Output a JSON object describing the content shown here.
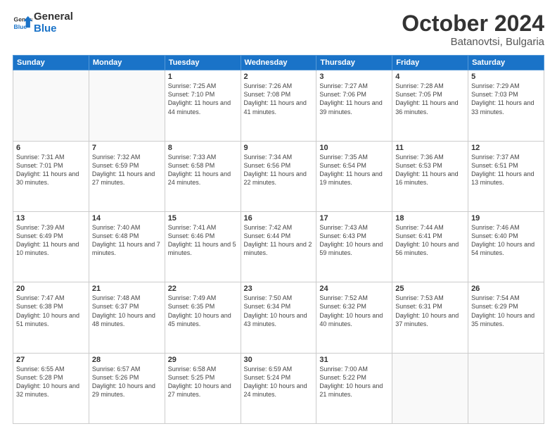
{
  "header": {
    "logo_line1": "General",
    "logo_line2": "Blue",
    "title": "October 2024",
    "subtitle": "Batanovtsi, Bulgaria"
  },
  "weekdays": [
    "Sunday",
    "Monday",
    "Tuesday",
    "Wednesday",
    "Thursday",
    "Friday",
    "Saturday"
  ],
  "weeks": [
    [
      {
        "day": "",
        "info": ""
      },
      {
        "day": "",
        "info": ""
      },
      {
        "day": "1",
        "info": "Sunrise: 7:25 AM\nSunset: 7:10 PM\nDaylight: 11 hours and 44 minutes."
      },
      {
        "day": "2",
        "info": "Sunrise: 7:26 AM\nSunset: 7:08 PM\nDaylight: 11 hours and 41 minutes."
      },
      {
        "day": "3",
        "info": "Sunrise: 7:27 AM\nSunset: 7:06 PM\nDaylight: 11 hours and 39 minutes."
      },
      {
        "day": "4",
        "info": "Sunrise: 7:28 AM\nSunset: 7:05 PM\nDaylight: 11 hours and 36 minutes."
      },
      {
        "day": "5",
        "info": "Sunrise: 7:29 AM\nSunset: 7:03 PM\nDaylight: 11 hours and 33 minutes."
      }
    ],
    [
      {
        "day": "6",
        "info": "Sunrise: 7:31 AM\nSunset: 7:01 PM\nDaylight: 11 hours and 30 minutes."
      },
      {
        "day": "7",
        "info": "Sunrise: 7:32 AM\nSunset: 6:59 PM\nDaylight: 11 hours and 27 minutes."
      },
      {
        "day": "8",
        "info": "Sunrise: 7:33 AM\nSunset: 6:58 PM\nDaylight: 11 hours and 24 minutes."
      },
      {
        "day": "9",
        "info": "Sunrise: 7:34 AM\nSunset: 6:56 PM\nDaylight: 11 hours and 22 minutes."
      },
      {
        "day": "10",
        "info": "Sunrise: 7:35 AM\nSunset: 6:54 PM\nDaylight: 11 hours and 19 minutes."
      },
      {
        "day": "11",
        "info": "Sunrise: 7:36 AM\nSunset: 6:53 PM\nDaylight: 11 hours and 16 minutes."
      },
      {
        "day": "12",
        "info": "Sunrise: 7:37 AM\nSunset: 6:51 PM\nDaylight: 11 hours and 13 minutes."
      }
    ],
    [
      {
        "day": "13",
        "info": "Sunrise: 7:39 AM\nSunset: 6:49 PM\nDaylight: 11 hours and 10 minutes."
      },
      {
        "day": "14",
        "info": "Sunrise: 7:40 AM\nSunset: 6:48 PM\nDaylight: 11 hours and 7 minutes."
      },
      {
        "day": "15",
        "info": "Sunrise: 7:41 AM\nSunset: 6:46 PM\nDaylight: 11 hours and 5 minutes."
      },
      {
        "day": "16",
        "info": "Sunrise: 7:42 AM\nSunset: 6:44 PM\nDaylight: 11 hours and 2 minutes."
      },
      {
        "day": "17",
        "info": "Sunrise: 7:43 AM\nSunset: 6:43 PM\nDaylight: 10 hours and 59 minutes."
      },
      {
        "day": "18",
        "info": "Sunrise: 7:44 AM\nSunset: 6:41 PM\nDaylight: 10 hours and 56 minutes."
      },
      {
        "day": "19",
        "info": "Sunrise: 7:46 AM\nSunset: 6:40 PM\nDaylight: 10 hours and 54 minutes."
      }
    ],
    [
      {
        "day": "20",
        "info": "Sunrise: 7:47 AM\nSunset: 6:38 PM\nDaylight: 10 hours and 51 minutes."
      },
      {
        "day": "21",
        "info": "Sunrise: 7:48 AM\nSunset: 6:37 PM\nDaylight: 10 hours and 48 minutes."
      },
      {
        "day": "22",
        "info": "Sunrise: 7:49 AM\nSunset: 6:35 PM\nDaylight: 10 hours and 45 minutes."
      },
      {
        "day": "23",
        "info": "Sunrise: 7:50 AM\nSunset: 6:34 PM\nDaylight: 10 hours and 43 minutes."
      },
      {
        "day": "24",
        "info": "Sunrise: 7:52 AM\nSunset: 6:32 PM\nDaylight: 10 hours and 40 minutes."
      },
      {
        "day": "25",
        "info": "Sunrise: 7:53 AM\nSunset: 6:31 PM\nDaylight: 10 hours and 37 minutes."
      },
      {
        "day": "26",
        "info": "Sunrise: 7:54 AM\nSunset: 6:29 PM\nDaylight: 10 hours and 35 minutes."
      }
    ],
    [
      {
        "day": "27",
        "info": "Sunrise: 6:55 AM\nSunset: 5:28 PM\nDaylight: 10 hours and 32 minutes."
      },
      {
        "day": "28",
        "info": "Sunrise: 6:57 AM\nSunset: 5:26 PM\nDaylight: 10 hours and 29 minutes."
      },
      {
        "day": "29",
        "info": "Sunrise: 6:58 AM\nSunset: 5:25 PM\nDaylight: 10 hours and 27 minutes."
      },
      {
        "day": "30",
        "info": "Sunrise: 6:59 AM\nSunset: 5:24 PM\nDaylight: 10 hours and 24 minutes."
      },
      {
        "day": "31",
        "info": "Sunrise: 7:00 AM\nSunset: 5:22 PM\nDaylight: 10 hours and 21 minutes."
      },
      {
        "day": "",
        "info": ""
      },
      {
        "day": "",
        "info": ""
      }
    ]
  ]
}
